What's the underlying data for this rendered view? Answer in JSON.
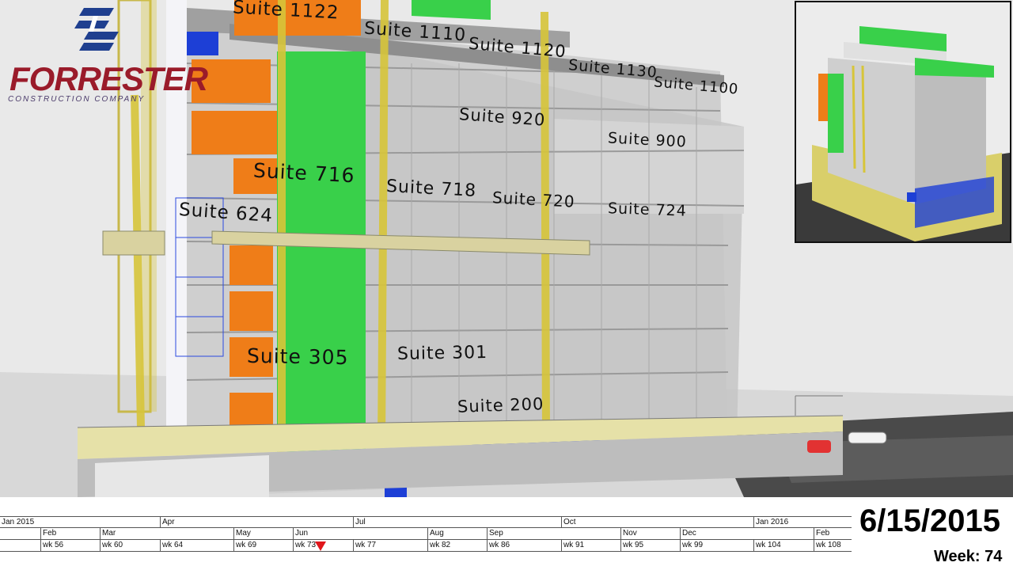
{
  "brand": {
    "name": "FORRESTER",
    "tagline": "CONSTRUCTION COMPANY",
    "primary_color": "#9a1b2a",
    "mark_color": "#1f3f8f"
  },
  "model": {
    "suites": [
      "Suite 1122",
      "Suite 1110",
      "Suite 1120",
      "Suite 1130",
      "Suite 1100",
      "Suite 920",
      "Suite 900",
      "Suite 716",
      "Suite 718",
      "Suite 720",
      "Suite 724",
      "Suite 624",
      "Suite 305",
      "Suite 301",
      "Suite 200"
    ],
    "colors": {
      "completed": "#ef7d18",
      "in_progress": "#39d04a",
      "glazing": "#1d3fd6",
      "hoist": "#d7c53a",
      "structure": "#d6d6d6"
    }
  },
  "timeline": {
    "years": [
      "Jan 2015",
      "Jan 2016"
    ],
    "months": [
      "Feb",
      "Mar",
      "Apr",
      "May",
      "Jun",
      "Jul",
      "Aug",
      "Sep",
      "Oct",
      "Nov",
      "Dec",
      "Feb"
    ],
    "weeks": [
      "wk 56",
      "wk 60",
      "wk 64",
      "wk 69",
      "wk 73",
      "wk 77",
      "wk 82",
      "wk 86",
      "wk 91",
      "wk 95",
      "wk 99",
      "wk 104",
      "wk 108"
    ],
    "current_week": 74,
    "marker_color": "#e0161b"
  },
  "status": {
    "date": "6/15/2015",
    "week": "Week: 74"
  }
}
